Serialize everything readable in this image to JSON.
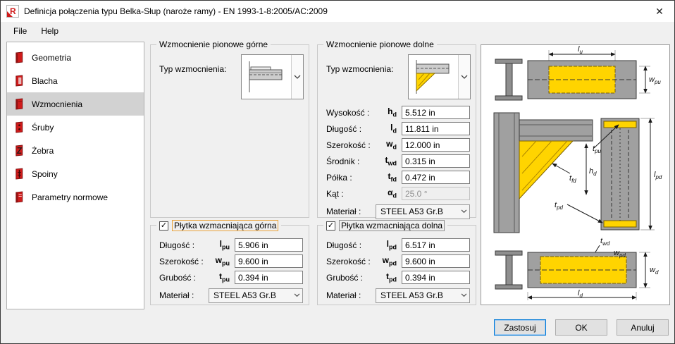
{
  "window": {
    "title": "Definicja połączenia typu Belka-Słup (naroże ramy) - EN 1993-1-8:2005/AC:2009",
    "close_glyph": "✕",
    "app_icon_letter": "R"
  },
  "menu": {
    "file": "File",
    "help": "Help"
  },
  "sidebar": {
    "items": [
      {
        "label": "Geometria"
      },
      {
        "label": "Blacha"
      },
      {
        "label": "Wzmocnienia"
      },
      {
        "label": "Śruby"
      },
      {
        "label": "Żebra"
      },
      {
        "label": "Spoiny"
      },
      {
        "label": "Parametry normowe"
      }
    ],
    "selected": "Wzmocnienia"
  },
  "upper_stiffener": {
    "title": "Wzmocnienie pionowe górne",
    "type_label": "Typ wzmocnienia:"
  },
  "lower_stiffener": {
    "title": "Wzmocnienie pionowe dolne",
    "type_label": "Typ wzmocnienia:",
    "fields": [
      {
        "label": "Wysokość :",
        "sym": "h",
        "sub": "d",
        "value": "5.512 in"
      },
      {
        "label": "Długość :",
        "sym": "l",
        "sub": "d",
        "value": "11.811 in"
      },
      {
        "label": "Szerokość :",
        "sym": "w",
        "sub": "d",
        "value": "12.000 in"
      },
      {
        "label": "Środnik :",
        "sym": "t",
        "sub": "wd",
        "value": "0.315 in"
      },
      {
        "label": "Półka :",
        "sym": "t",
        "sub": "fd",
        "value": "0.472 in"
      },
      {
        "label": "Kąt :",
        "sym": "α",
        "sub": "d",
        "value": "25.0 °",
        "disabled": true
      }
    ],
    "material_label": "Materiał :",
    "material": "STEEL A53 Gr.B"
  },
  "upper_plate": {
    "title": "Płytka wzmacniająca górna",
    "checked": true,
    "check_glyph": "✓",
    "fields": [
      {
        "label": "Długość :",
        "sym": "l",
        "sub": "pu",
        "value": "5.906 in"
      },
      {
        "label": "Szerokość :",
        "sym": "w",
        "sub": "pu",
        "value": "9.600 in"
      },
      {
        "label": "Grubość :",
        "sym": "t",
        "sub": "pu",
        "value": "0.394 in"
      }
    ],
    "material_label": "Materiał :",
    "material": "STEEL A53 Gr.B"
  },
  "lower_plate": {
    "title": "Płytka wzmacniająca dolna",
    "checked": true,
    "check_glyph": "✓",
    "fields": [
      {
        "label": "Długość :",
        "sym": "l",
        "sub": "pd",
        "value": "6.517 in"
      },
      {
        "label": "Szerokość :",
        "sym": "w",
        "sub": "pd",
        "value": "9.600 in"
      },
      {
        "label": "Grubość :",
        "sym": "t",
        "sub": "pd",
        "value": "0.394 in"
      }
    ],
    "material_label": "Materiał :",
    "material": "STEEL A53 Gr.B"
  },
  "diagram": {
    "dims": {
      "lu": {
        "m": "l",
        "s": "u"
      },
      "wpu": {
        "m": "w",
        "s": "pu"
      },
      "tpu": {
        "m": "t",
        "s": "pu"
      },
      "hd": {
        "m": "h",
        "s": "d"
      },
      "tfd": {
        "m": "t",
        "s": "fd"
      },
      "tpd": {
        "m": "t",
        "s": "pd"
      },
      "lpd": {
        "m": "l",
        "s": "pd"
      },
      "twd": {
        "m": "t",
        "s": "wd"
      },
      "wpd": {
        "m": "w",
        "s": "pd"
      },
      "wd": {
        "m": "w",
        "s": "d"
      },
      "ld": {
        "m": "l",
        "s": "d"
      }
    }
  },
  "buttons": {
    "apply": "Zastosuj",
    "ok": "OK",
    "cancel": "Anuluj"
  },
  "colors": {
    "accent": "#0078d7",
    "plate_yellow": "#ffd400",
    "steel_gray": "#a0a0a0",
    "icon_red": "#cf1b1b"
  }
}
